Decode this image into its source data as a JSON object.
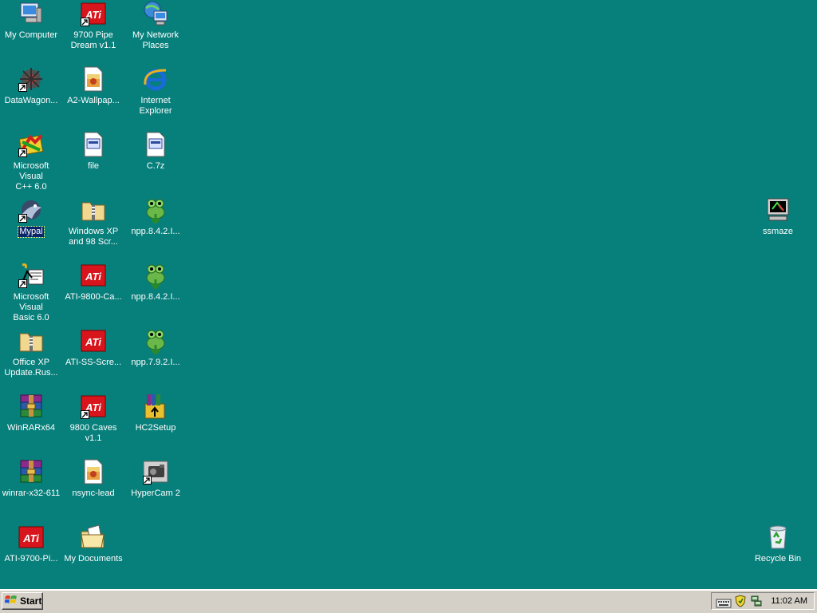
{
  "desktop": {
    "background_color": "#077f7b",
    "icons": [
      {
        "label": "My Computer",
        "icon": "my-computer-icon",
        "selected": false,
        "shortcut": false
      },
      {
        "label": "9700 Pipe\nDream v1.1",
        "icon": "ati-logo-icon",
        "selected": false,
        "shortcut": true
      },
      {
        "label": "My Network\nPlaces",
        "icon": "network-places-icon",
        "selected": false,
        "shortcut": false
      },
      {
        "label": "DataWagon...",
        "icon": "datawagon-icon",
        "selected": false,
        "shortcut": true
      },
      {
        "label": "A2-Wallpap...",
        "icon": "image-file-icon",
        "selected": false,
        "shortcut": false
      },
      {
        "label": "Internet\nExplorer",
        "icon": "internet-explorer-icon",
        "selected": false,
        "shortcut": false
      },
      {
        "label": "Microsoft Visual\nC++ 6.0",
        "icon": "visual-cpp-icon",
        "selected": false,
        "shortcut": true
      },
      {
        "label": "file",
        "icon": "generic-file-icon",
        "selected": false,
        "shortcut": false
      },
      {
        "label": "C.7z",
        "icon": "generic-file-icon",
        "selected": false,
        "shortcut": false
      },
      {
        "label": "Mypal",
        "icon": "mypal-browser-icon",
        "selected": true,
        "shortcut": true
      },
      {
        "label": "Windows XP\nand 98 Scr...",
        "icon": "zip-folder-icon",
        "selected": false,
        "shortcut": false
      },
      {
        "label": "npp.8.4.2.I...",
        "icon": "notepad-plus-plus-icon",
        "selected": false,
        "shortcut": false
      },
      {
        "label": "Microsoft Visual\nBasic 6.0",
        "icon": "visual-basic-icon",
        "selected": false,
        "shortcut": true
      },
      {
        "label": "ATI-9800-Ca...",
        "icon": "ati-logo-icon",
        "selected": false,
        "shortcut": false
      },
      {
        "label": "npp.8.4.2.I...",
        "icon": "notepad-plus-plus-icon",
        "selected": false,
        "shortcut": false
      },
      {
        "label": "Office XP\nUpdate.Rus...",
        "icon": "zip-folder-icon",
        "selected": false,
        "shortcut": false
      },
      {
        "label": "ATI-SS-Scre...",
        "icon": "ati-logo-icon",
        "selected": false,
        "shortcut": false
      },
      {
        "label": "npp.7.9.2.I...",
        "icon": "notepad-plus-plus-icon",
        "selected": false,
        "shortcut": false
      },
      {
        "label": "WinRARx64",
        "icon": "winrar-icon",
        "selected": false,
        "shortcut": false
      },
      {
        "label": "9800 Caves\nv1.1",
        "icon": "ati-logo-icon",
        "selected": false,
        "shortcut": true
      },
      {
        "label": "HC2Setup",
        "icon": "installer-icon",
        "selected": false,
        "shortcut": false
      },
      {
        "label": "winrar-x32-611",
        "icon": "winrar-icon",
        "selected": false,
        "shortcut": false
      },
      {
        "label": "nsync-lead",
        "icon": "image-file-icon",
        "selected": false,
        "shortcut": false
      },
      {
        "label": "HyperCam 2",
        "icon": "hypercam-icon",
        "selected": false,
        "shortcut": true
      },
      {
        "label": "ATI-9700-Pi...",
        "icon": "ati-logo-icon",
        "selected": false,
        "shortcut": false
      },
      {
        "label": "My Documents",
        "icon": "my-documents-icon",
        "selected": false,
        "shortcut": false
      },
      {
        "label": "ssmaze",
        "icon": "screensaver-icon",
        "selected": false,
        "shortcut": false
      },
      {
        "label": "Recycle Bin",
        "icon": "recycle-bin-icon",
        "selected": false,
        "shortcut": false
      }
    ]
  },
  "taskbar": {
    "start_label": "Start",
    "tray_icons": [
      "keyboard-icon",
      "security-shield-icon",
      "network-icon"
    ],
    "clock": "11:02 AM"
  }
}
